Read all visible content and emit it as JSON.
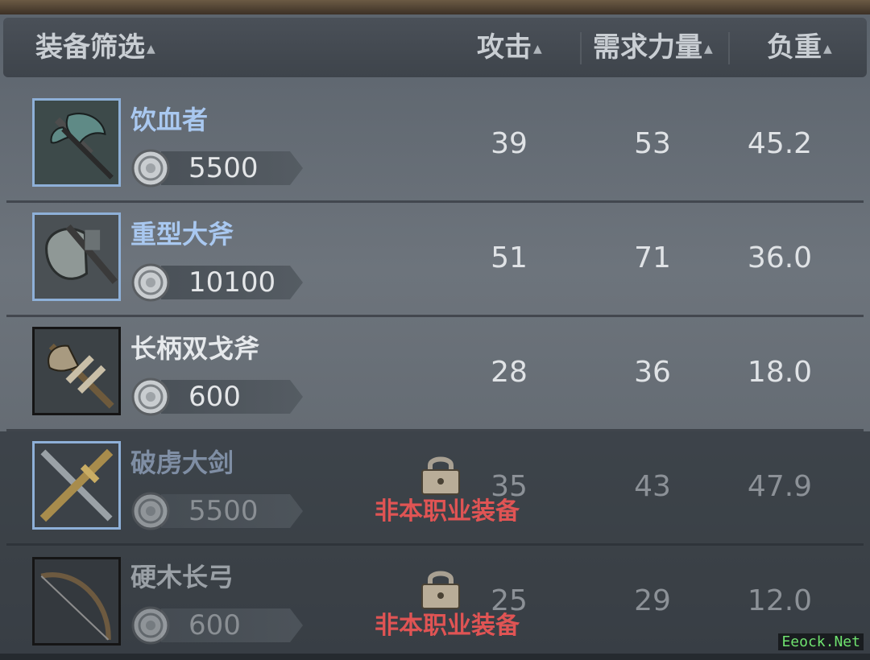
{
  "header": {
    "filter_label": "装备筛选",
    "attack_label": "攻击",
    "strength_label": "需求力量",
    "weight_label": "负重",
    "sort_icon": "triangle-up-icon"
  },
  "items": [
    {
      "name": "饮血者",
      "price": "5500",
      "attack": "39",
      "strength": "53",
      "weight": "45.2",
      "locked": false,
      "lock_text": "",
      "icon": "axe-icon"
    },
    {
      "name": "重型大斧",
      "price": "10100",
      "attack": "51",
      "strength": "71",
      "weight": "36.0",
      "locked": false,
      "lock_text": "",
      "icon": "great-axe-icon"
    },
    {
      "name": "长柄双戈斧",
      "price": "600",
      "attack": "28",
      "strength": "36",
      "weight": "18.0",
      "locked": false,
      "lock_text": "",
      "icon": "halberd-icon"
    },
    {
      "name": "破虏大剑",
      "price": "5500",
      "attack": "35",
      "strength": "43",
      "weight": "47.9",
      "locked": true,
      "lock_text": "非本职业装备",
      "icon": "greatsword-icon"
    },
    {
      "name": "硬木长弓",
      "price": "600",
      "attack": "25",
      "strength": "29",
      "weight": "12.0",
      "locked": true,
      "lock_text": "非本职业装备",
      "icon": "longbow-icon"
    }
  ],
  "currency_icon": "silver-coin-icon",
  "lock_icon": "padlock-icon",
  "watermark": "Eeock.Net",
  "colors": {
    "name_blue": "#a9c8f0",
    "lock_red": "#e05454",
    "frame_blue": "#8eb0d8"
  }
}
